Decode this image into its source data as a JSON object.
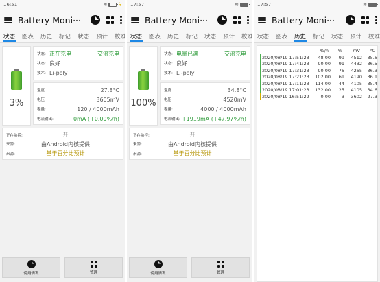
{
  "statusbar": {
    "time_left": "16:51",
    "time_mid": "17:57",
    "time_right": "17:57"
  },
  "app": {
    "title": "Battery Moni···"
  },
  "tabs": [
    "状态",
    "图表",
    "历史",
    "标记",
    "状态",
    "预计",
    "校准"
  ],
  "tabs_right": [
    "状态",
    "图表",
    "历史",
    "标记",
    "状态",
    "预计",
    "校准"
  ],
  "active_tabs": {
    "pane1": 0,
    "pane2": 0,
    "pane3": 2
  },
  "colors": {
    "accent": "#1e88e5",
    "green": "#2e9b3a",
    "gold": "#b49300",
    "battery_green": "#4caf2f"
  },
  "labels": {
    "status": "状态:",
    "health": "状态:",
    "tech": "技术:",
    "temp": "温度",
    "voltage": "电压",
    "capacity": "容量:",
    "current": "电流输出:",
    "monitoring": "正在监控:",
    "source": "来源:",
    "source2": "来源:"
  },
  "pane1": {
    "percent": "3%",
    "status": "正在充电",
    "charge_type": "交流充电",
    "health": "良好",
    "technology": "Li-poly",
    "temperature": "27.8°C",
    "voltage": "3605mV",
    "capacity": "120 / 4000mAh",
    "current": "+0mA (+0.00%/h)",
    "monitoring": "开",
    "source": "由Android内核提供",
    "estimate": "基于百分比预计",
    "battery_level": 0.03
  },
  "pane2": {
    "percent": "100%",
    "status": "电量已满",
    "charge_type": "交流充电",
    "health": "良好",
    "technology": "Li-poly",
    "temperature": "34.8°C",
    "voltage": "4520mV",
    "capacity": "4000 / 4000mAh",
    "current": "+1919mA (+47.97%/h)",
    "monitoring": "开",
    "source": "由Android内核提供",
    "estimate": "基于百分比预计",
    "battery_level": 1.0
  },
  "bottom": {
    "usage": "使用情况",
    "manage": "管理"
  },
  "history": {
    "headers": [
      "%/h",
      "%",
      "mV",
      "°C"
    ],
    "rows": [
      [
        "2020/08/19 17:51:23",
        "48.00",
        "99",
        "4512",
        "35.6"
      ],
      [
        "2020/08/19 17:41:23",
        "90.00",
        "91",
        "4432",
        "36.5"
      ],
      [
        "2020/08/19 17:31:23",
        "90.00",
        "76",
        "4265",
        "36.3"
      ],
      [
        "2020/08/19 17:21:23",
        "102.00",
        "61",
        "4190",
        "36.1"
      ],
      [
        "2020/08/19 17:11:23",
        "114.00",
        "44",
        "4105",
        "35.4"
      ],
      [
        "2020/08/19 17:01:23",
        "132.00",
        "25",
        "4105",
        "34.6"
      ],
      [
        "2020/08/19 16:51:22",
        "0.00",
        "3",
        "3602",
        "27.3"
      ]
    ],
    "bar_colors": [
      "#4caf50",
      "#4caf50",
      "#4caf50",
      "#4caf50",
      "#4caf50",
      "#4caf50",
      "#d4b000"
    ]
  }
}
